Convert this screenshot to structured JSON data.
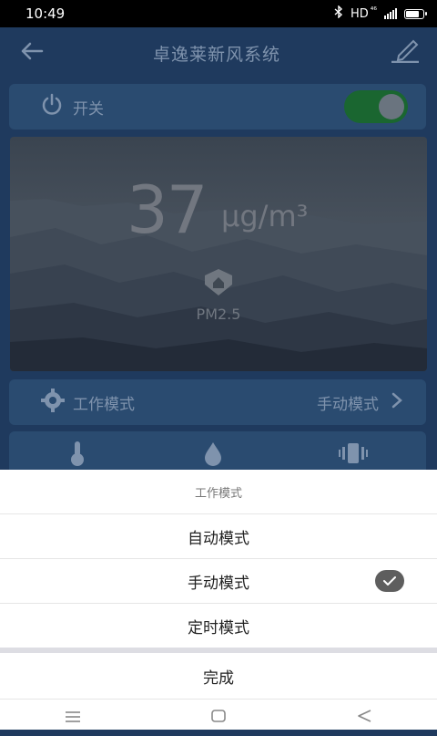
{
  "status_bar": {
    "time": "10:49",
    "network": "HD",
    "network_sub": "⁴⁶",
    "battery_level": 0.8
  },
  "header": {
    "title": "卓逸莱新风系统",
    "back_icon": "arrow-left-icon",
    "edit_icon": "pencil-icon"
  },
  "power": {
    "label": "开关",
    "on": true
  },
  "air": {
    "value": "37",
    "unit": "μg/m³",
    "name": "PM2.5"
  },
  "work_mode": {
    "label": "工作模式",
    "value": "手动模式"
  },
  "sensors": [
    {
      "icon": "thermometer-icon"
    },
    {
      "icon": "water-drop-icon"
    },
    {
      "icon": "vibration-icon"
    }
  ],
  "picker": {
    "title": "工作模式",
    "options": [
      "自动模式",
      "手动模式",
      "定时模式"
    ],
    "selected_index": 1,
    "done_label": "完成"
  },
  "navbar": {
    "items": [
      "menu-icon",
      "home-icon",
      "back-icon"
    ]
  },
  "colors": {
    "background": "#1f3a5e",
    "card": "#2a4b70",
    "toggle_on": "#1a6630"
  }
}
